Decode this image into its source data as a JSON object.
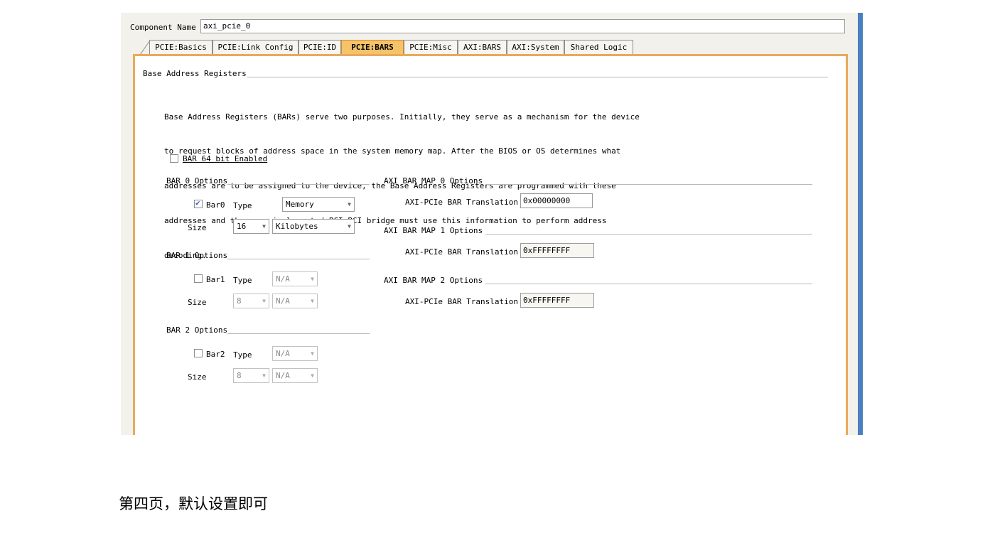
{
  "component": {
    "label": "Component Name",
    "value": "axi_pcie_0"
  },
  "tabs": [
    "PCIE:Basics",
    "PCIE:Link Config",
    "PCIE:ID",
    "PCIE:BARS",
    "PCIE:Misc",
    "AXI:BARS",
    "AXI:System",
    "Shared Logic"
  ],
  "active_tab": "PCIE:BARS",
  "section_title": "Base Address Registers",
  "description": [
    "Base Address Registers (BARs) serve two purposes. Initially, they serve as a mechanism for the device",
    "to request blocks of address space in the system memory map. After the BIOS or OS determines what",
    "addresses are to be assigned to the device, the Base Address Registers are programmed with these",
    "addresses and the user implemented PCI-PCI bridge must use this information to perform address",
    "decoding."
  ],
  "bar64": {
    "label": "BAR 64 bit Enabled",
    "checked": false
  },
  "bars": [
    {
      "title": "BAR 0 Options",
      "check_label": "Bar0",
      "checked": true,
      "type_label": "Type",
      "type": "Memory",
      "size_label": "Size",
      "size": "16",
      "unit": "Kilobytes"
    },
    {
      "title": "BAR 1 Options",
      "check_label": "Bar1",
      "checked": false,
      "type_label": "Type",
      "type": "N/A",
      "size_label": "Size",
      "size": "8",
      "unit": "N/A"
    },
    {
      "title": "BAR 2 Options",
      "check_label": "Bar2",
      "checked": false,
      "type_label": "Type",
      "type": "N/A",
      "size_label": "Size",
      "size": "8",
      "unit": "N/A"
    }
  ],
  "axi_maps": [
    {
      "title": "AXI BAR MAP 0 Options",
      "label": "AXI-PCIe BAR Translation",
      "value": "0x00000000"
    },
    {
      "title": "AXI BAR MAP 1 Options",
      "label": "AXI-PCIe BAR Translation",
      "value": "0xFFFFFFFF"
    },
    {
      "title": "AXI BAR MAP 2 Options",
      "label": "AXI-PCIe BAR Translation",
      "value": "0xFFFFFFFF"
    }
  ],
  "caption": "第四页，默认设置即可",
  "colors": {
    "accent_tab": "#f5c36a",
    "panel_border": "#e9a95a",
    "window_edge": "#4a7fc2"
  }
}
